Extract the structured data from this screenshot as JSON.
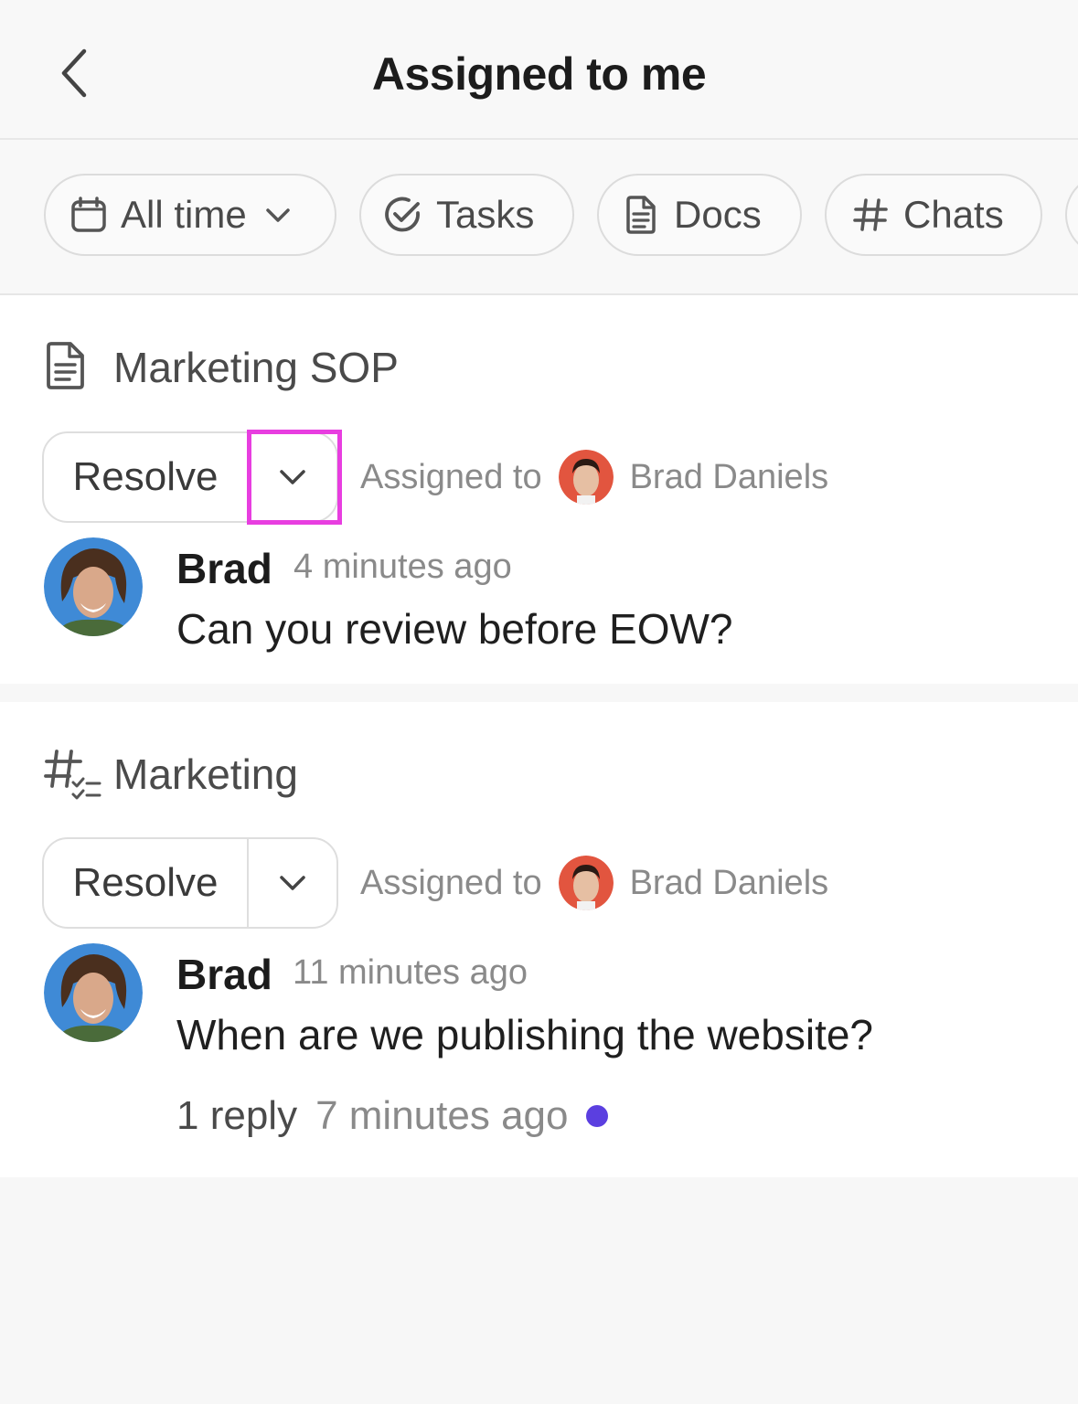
{
  "header": {
    "title": "Assigned to me"
  },
  "filters": [
    {
      "label": "All time",
      "icon": "calendar-icon"
    },
    {
      "label": "Tasks",
      "icon": "check-circle-icon"
    },
    {
      "label": "Docs",
      "icon": "document-icon"
    },
    {
      "label": "Chats",
      "icon": "hashtag-icon"
    }
  ],
  "items": [
    {
      "section_title": "Marketing SOP",
      "section_icon": "document-icon",
      "resolve_label": "Resolve",
      "assigned_prefix": "Assigned to",
      "assignee": "Brad Daniels",
      "author": "Brad",
      "time": "4 minutes ago",
      "message": "Can you review before EOW?"
    },
    {
      "section_title": "Marketing",
      "section_icon": "chat-list-icon",
      "resolve_label": "Resolve",
      "assigned_prefix": "Assigned to",
      "assignee": "Brad Daniels",
      "author": "Brad",
      "time": "11 minutes ago",
      "message": "When are we publishing the website?",
      "reply_count": "1 reply",
      "reply_time": "7 minutes ago"
    }
  ],
  "colors": {
    "accent_unread": "#5b3fe0",
    "highlight": "#e83ee0"
  }
}
